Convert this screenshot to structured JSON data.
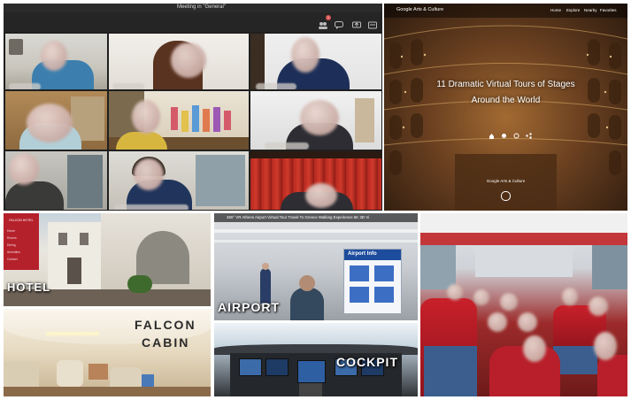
{
  "teams": {
    "meeting_title": "Meeting in \"General\"",
    "badge_count": "1"
  },
  "arts_culture": {
    "brand": "Google Arts & Culture",
    "nav": [
      "Home",
      "Explore",
      "Nearby",
      "Favorites"
    ],
    "headline_line1": "11 Dramatic Virtual Tours of Stages",
    "headline_line2": "Around the World",
    "footer_brand": "Google Arts & Culture"
  },
  "hotel": {
    "logo_text": "FALCON HOTEL",
    "menu": [
      "Home",
      "Rooms",
      "Dining",
      "Amenities",
      "Contact"
    ],
    "label": "HOTEL"
  },
  "airport": {
    "video_title": "360° VR Athens Airport Virtual Tour Travel To Greece Walking Experience 5K 3D Vi",
    "sign_text": "Airport Info",
    "label": "AIRPORT"
  },
  "cabin": {
    "label_line1": "FALCON",
    "label_line2": "CABIN"
  },
  "cockpit": {
    "label": "COCKPIT"
  },
  "icons": [
    "people-icon",
    "chat-icon",
    "share-icon",
    "more-icon",
    "home-icon",
    "bell-icon",
    "compass-icon",
    "share-nodes-icon"
  ],
  "colors": {
    "teams_bg": "#1f1f1f",
    "bus_seat_red": "#c8202a",
    "curtain_red": "#b3271e",
    "hotel_red": "#b5212b"
  }
}
